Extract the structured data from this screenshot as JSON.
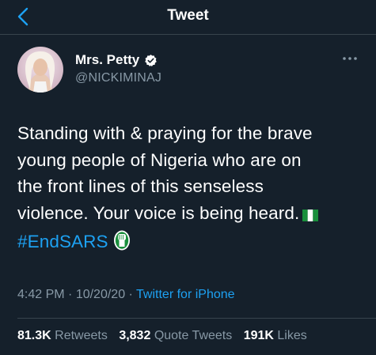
{
  "header": {
    "title": "Tweet",
    "back_icon": "chevron-left-icon"
  },
  "author": {
    "display_name": "Mrs. Petty",
    "handle": "@NICKIMINAJ",
    "verified_icon": "verified-badge-icon"
  },
  "tweet": {
    "text_line1": "Standing with & praying for the brave",
    "text_line2": "young people of Nigeria who are on",
    "text_line3": "the front lines of this senseless",
    "text_line4": "violence. Your voice is being heard.",
    "hashtag": "#EndSARS",
    "flag_icon": "nigeria-flag-icon",
    "hashflag_icon": "endsars-fist-icon"
  },
  "meta": {
    "time": "4:42 PM",
    "separator1": " · ",
    "date": "10/20/20",
    "separator2": " · ",
    "source": "Twitter for iPhone"
  },
  "stats": {
    "retweets_count": "81.3K",
    "retweets_label": "Retweets",
    "quote_count": "3,832",
    "quote_label": "Quote Tweets",
    "likes_count": "191K",
    "likes_label": "Likes"
  },
  "colors": {
    "background": "#15202b",
    "accent": "#1da1f2",
    "secondary_text": "#8899a6",
    "divider": "#38444d"
  }
}
